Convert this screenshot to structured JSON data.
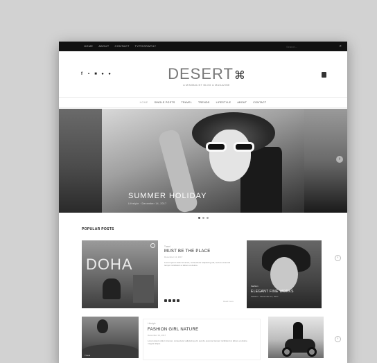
{
  "topbar": {
    "menu": [
      "Home",
      "About",
      "Contact",
      "Typography"
    ],
    "search_placeholder": "Search..."
  },
  "header": {
    "logo": "DESERT",
    "tagline": "A minimalist blog & magazine",
    "social_icons": [
      "facebook-icon",
      "twitter-icon",
      "instagram-icon",
      "pinterest-icon",
      "rss-icon"
    ]
  },
  "nav": {
    "items": [
      "Home",
      "Single Posts",
      "Travel",
      "Trends",
      "Lifestyle",
      "About",
      "Contact"
    ]
  },
  "slider": {
    "title": "SUMMER HOLIDAY",
    "meta": "Lifestyle · December 14, 2017"
  },
  "popular": {
    "heading": "POPULAR POSTS",
    "doha_word": "DOHA",
    "card1": {
      "category": "Travel",
      "title": "MUST BE THE PLACE",
      "meta": "December 14, 2017",
      "excerpt": "Lorem ipsum dolor sit amet, consectetur adipiscing elit, sed do eiusmod tempor incididunt ut labore et dolore.",
      "more": "Read more"
    },
    "card2": {
      "category": "Fashion",
      "title": "ELEGANT FINE WORKS",
      "meta": "Fashion · December 14, 2017"
    },
    "card3": {
      "category": "Lifestyle",
      "title": "FASHION GIRL NATURE",
      "meta": "December 14, 2017",
      "excerpt": "Lorem ipsum dolor sit amet, consectetur adipiscing elit, sed do eiusmod tempor incididunt ut labore et dolore magna aliqua."
    },
    "balloon_label": "Travel"
  }
}
